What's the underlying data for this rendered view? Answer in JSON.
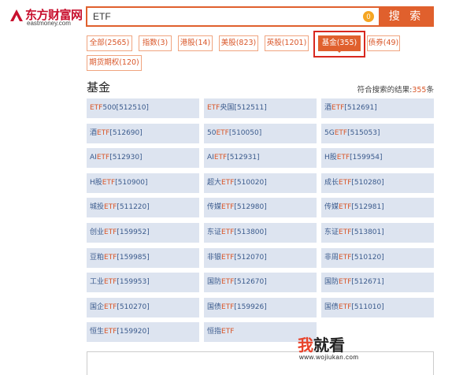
{
  "header": {
    "logo_text": "东方财富网",
    "logo_domain": "eastmoney.com",
    "search_value": "ETF",
    "clear_icon_glyph": "0",
    "search_button": "搜 索"
  },
  "tabs": [
    {
      "label": "全部(2565)",
      "active": false
    },
    {
      "label": "指数(3)",
      "active": false
    },
    {
      "label": "港股(14)",
      "active": false
    },
    {
      "label": "美股(823)",
      "active": false
    },
    {
      "label": "英股(1201)",
      "active": false
    },
    {
      "label": "基金(355)",
      "active": true
    },
    {
      "label": "债券(49)",
      "active": false
    },
    {
      "label": "期货期权(120)",
      "active": false
    }
  ],
  "section": {
    "title": "基金",
    "result_prefix": "符合搜索的结果:",
    "result_count": "355",
    "result_suffix": "条"
  },
  "results": [
    {
      "pre": "",
      "hl": "ETF",
      "post": "500[512510]"
    },
    {
      "pre": "",
      "hl": "ETF",
      "post": "央国[512511]"
    },
    {
      "pre": "酒",
      "hl": "ETF",
      "post": "[512691]"
    },
    {
      "pre": "酒",
      "hl": "ETF",
      "post": "[512690]"
    },
    {
      "pre": "50",
      "hl": "ETF",
      "post": "[510050]"
    },
    {
      "pre": "5G",
      "hl": "ETF",
      "post": "[515053]"
    },
    {
      "pre": "AI",
      "hl": "ETF",
      "post": "[512930]"
    },
    {
      "pre": "AI",
      "hl": "ETF",
      "post": "[512931]"
    },
    {
      "pre": "H股",
      "hl": "ETF",
      "post": "[159954]"
    },
    {
      "pre": "H股",
      "hl": "ETF",
      "post": "[510900]"
    },
    {
      "pre": "超大",
      "hl": "ETF",
      "post": "[510020]"
    },
    {
      "pre": "成长",
      "hl": "ETF",
      "post": "[510280]"
    },
    {
      "pre": "城投",
      "hl": "ETF",
      "post": "[511220]"
    },
    {
      "pre": "传媒",
      "hl": "ETF",
      "post": "[512980]"
    },
    {
      "pre": "传媒",
      "hl": "ETF",
      "post": "[512981]"
    },
    {
      "pre": "创业",
      "hl": "ETF",
      "post": "[159952]"
    },
    {
      "pre": "东证",
      "hl": "ETF",
      "post": "[513800]"
    },
    {
      "pre": "东证",
      "hl": "ETF",
      "post": "[513801]"
    },
    {
      "pre": "豆粕",
      "hl": "ETF",
      "post": "[159985]"
    },
    {
      "pre": "非银",
      "hl": "ETF",
      "post": "[512070]"
    },
    {
      "pre": "非周",
      "hl": "ETF",
      "post": "[510120]"
    },
    {
      "pre": "工业",
      "hl": "ETF",
      "post": "[159953]"
    },
    {
      "pre": "国防",
      "hl": "ETF",
      "post": "[512670]"
    },
    {
      "pre": "国防",
      "hl": "ETF",
      "post": "[512671]"
    },
    {
      "pre": "国企",
      "hl": "ETF",
      "post": "[510270]"
    },
    {
      "pre": "国债",
      "hl": "ETF",
      "post": "[159926]"
    },
    {
      "pre": "国债",
      "hl": "ETF",
      "post": "[511010]"
    },
    {
      "pre": "恒生",
      "hl": "ETF",
      "post": "[159920]"
    },
    {
      "pre": "恒指",
      "hl": "ETF",
      "post": ""
    }
  ],
  "watermark": {
    "big_a": "我",
    "big_b": "就看",
    "url": "www.wojiukan.com"
  },
  "colors": {
    "brand": "#e0602d",
    "highlight": "#d9572a",
    "link": "#3a5a8c",
    "cell_bg": "#dde4f0",
    "annotation_box": "#d8281f"
  }
}
